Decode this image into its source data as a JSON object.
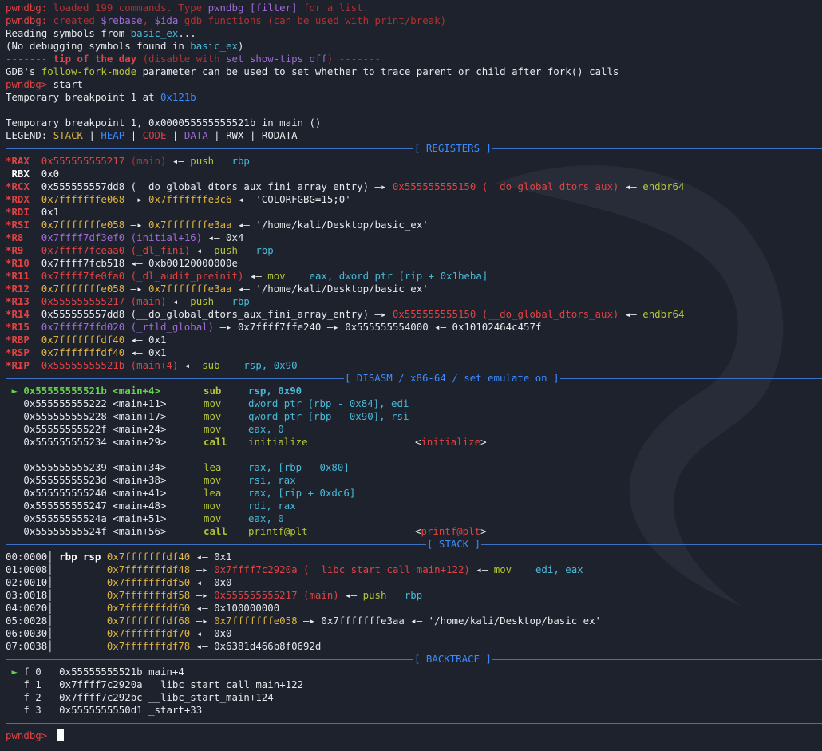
{
  "terminal": {
    "prompt": "pwndbg>",
    "lines": {
      "l1_tag": "pwndbg:",
      "l1_text": " loaded 199 commands. Type ",
      "l1_cmd": "pwndbg [filter]",
      "l1_end": " for a list.",
      "l2_tag": "pwndbg:",
      "l2_text": " created ",
      "l2_rebase": "$rebase",
      "l2_comma": ", ",
      "l2_ida": "$ida",
      "l2_end": " gdb functions (can be used with print/break)",
      "l3_text": "Reading symbols from ",
      "l3_file": "basic_ex",
      "l3_end": "...",
      "l4_text": "(No debugging symbols found in ",
      "l4_file": "basic_ex",
      "l4_end": ")",
      "l5_dash1": "------- ",
      "l5_tip": "tip of the day",
      "l5_mid": " (disable with ",
      "l5_cmd": "set show-tips off",
      "l5_end": ") -------",
      "l6_text": "GDB's ",
      "l6_param": "follow-fork-mode",
      "l6_end": " parameter can be used to set whether to trace parent or child after fork() calls",
      "l7_cmd": " start",
      "l8_text": "Temporary breakpoint 1 at ",
      "l8_addr": "0x121b",
      "l9_text": "Temporary breakpoint 1, 0x000055555555521b in main ()",
      "legend_label": "LEGEND: ",
      "legend_stack": "STACK",
      "legend_heap": "HEAP",
      "legend_code": "CODE",
      "legend_data": "DATA",
      "legend_rwx": "RWX",
      "legend_rodata": "RODATA",
      "legend_sep": " | "
    },
    "sections": {
      "registers": "[ REGISTERS ]",
      "disasm": "[ DISASM / x86-64 / set emulate on ]",
      "stack": "[ STACK ]",
      "backtrace": "[ BACKTRACE ]"
    },
    "registers": [
      {
        "name": "*RAX",
        "a": "0x555555555217",
        "b": " (main)",
        "c": " ◂— ",
        "d": "push",
        "e": "   rbp"
      },
      {
        "name": " RBX",
        "a": "0x0"
      },
      {
        "name": "*RCX",
        "a": "0x555555557dd8 (__do_global_dtors_aux_fini_array_entry) —▸ ",
        "b": "0x555555555150 (__do_global_dtors_aux)",
        "c": " ◂— ",
        "d": "endbr64"
      },
      {
        "name": "*RDX",
        "a": "0x7fffffffe068",
        "b": " —▸ ",
        "c": "0x7fffffffe3c6",
        "d": " ◂— 'COLORFGBG=15;0'"
      },
      {
        "name": "*RDI",
        "a": "0x1"
      },
      {
        "name": "*RSI",
        "a": "0x7fffffffe058",
        "b": " —▸ ",
        "c": "0x7fffffffe3aa",
        "d": " ◂— '/home/kali/Desktop/basic_ex'"
      },
      {
        "name": "*R8",
        "a": "0x7ffff7df3ef0 (initial+16)",
        "b": " ◂— 0x4"
      },
      {
        "name": "*R9",
        "a": "0x7ffff7fceaa0 (_dl_fini)",
        "b": " ◂— ",
        "c": "push",
        "d": "   rbp"
      },
      {
        "name": "*R10",
        "a": "0x7ffff7fcb518 ◂— 0xb00120000000e"
      },
      {
        "name": "*R11",
        "a": "0x7ffff7fe0fa0 (_dl_audit_preinit)",
        "b": " ◂— ",
        "c": "mov",
        "d": "    eax, dword ptr [rip + 0x1beba]"
      },
      {
        "name": "*R12",
        "a": "0x7fffffffe058",
        "b": " —▸ ",
        "c": "0x7fffffffe3aa",
        "d": " ◂— '/home/kali/Desktop/basic_ex'"
      },
      {
        "name": "*R13",
        "a": "0x555555555217 (main)",
        "b": " ◂— ",
        "c": "push",
        "d": "   rbp"
      },
      {
        "name": "*R14",
        "a": "0x555555557dd8 (__do_global_dtors_aux_fini_array_entry) —▸ ",
        "b": "0x555555555150 (__do_global_dtors_aux)",
        "c": " ◂— ",
        "d": "endbr64"
      },
      {
        "name": "*R15",
        "a": "0x7ffff7ffd020 (_rtld_global)",
        "b": " —▸ ",
        "c": "0x7ffff7ffe240 —▸ 0x555555554000 ◂— 0x10102464c457f"
      },
      {
        "name": "*RBP",
        "a": "0x7fffffffdf40",
        "b": " ◂— 0x1"
      },
      {
        "name": "*RSP",
        "a": "0x7fffffffdf40",
        "b": " ◂— 0x1"
      },
      {
        "name": "*RIP",
        "a": "0x55555555521b (main+4)",
        "b": " ◂— ",
        "c": "sub",
        "d": "    rsp, 0x90"
      }
    ],
    "disasm": [
      {
        "mark": " ► ",
        "addr": "0x55555555521b",
        "sym": " <main+4>",
        "mn": "sub",
        "ops": "rsp, 0x90",
        "tgt": "",
        "current": true
      },
      {
        "mark": "   ",
        "addr": "0x555555555222",
        "sym": " <main+11>",
        "mn": "mov",
        "ops": "dword ptr [rbp - 0x84], edi",
        "tgt": ""
      },
      {
        "mark": "   ",
        "addr": "0x555555555228",
        "sym": " <main+17>",
        "mn": "mov",
        "ops": "qword ptr [rbp - 0x90], rsi",
        "tgt": ""
      },
      {
        "mark": "   ",
        "addr": "0x55555555522f",
        "sym": " <main+24>",
        "mn": "mov",
        "ops": "eax, 0",
        "tgt": ""
      },
      {
        "mark": "   ",
        "addr": "0x555555555234",
        "sym": " <main+29>",
        "mn": "call",
        "ops": "initialize",
        "tgt": "initialize",
        "call": true
      },
      {
        "blank": true
      },
      {
        "mark": "   ",
        "addr": "0x555555555239",
        "sym": " <main+34>",
        "mn": "lea",
        "ops": "rax, [rbp - 0x80]",
        "tgt": ""
      },
      {
        "mark": "   ",
        "addr": "0x55555555523d",
        "sym": " <main+38>",
        "mn": "mov",
        "ops": "rsi, rax",
        "tgt": ""
      },
      {
        "mark": "   ",
        "addr": "0x555555555240",
        "sym": " <main+41>",
        "mn": "lea",
        "ops": "rax, [rip + 0xdc6]",
        "tgt": ""
      },
      {
        "mark": "   ",
        "addr": "0x555555555247",
        "sym": " <main+48>",
        "mn": "mov",
        "ops": "rdi, rax",
        "tgt": ""
      },
      {
        "mark": "   ",
        "addr": "0x55555555524a",
        "sym": " <main+51>",
        "mn": "mov",
        "ops": "eax, 0",
        "tgt": ""
      },
      {
        "mark": "   ",
        "addr": "0x55555555524f",
        "sym": " <main+56>",
        "mn": "call",
        "ops": "printf@plt",
        "tgt": "printf@plt",
        "call": true
      }
    ],
    "stack": [
      {
        "idx": "00:0000",
        "regs": " rbp rsp ",
        "addr": "0x7fffffffdf40",
        "rest": " ◂— 0x1"
      },
      {
        "idx": "01:0008",
        "regs": "         ",
        "addr": "0x7fffffffdf48",
        "arrow": " —▸ ",
        "ptr": "0x7ffff7c2920a (__libc_start_call_main+122)",
        "tail": " ◂— ",
        "mn": "mov",
        "ops": "    edi, eax"
      },
      {
        "idx": "02:0010",
        "regs": "         ",
        "addr": "0x7fffffffdf50",
        "rest": " ◂— 0x0"
      },
      {
        "idx": "03:0018",
        "regs": "         ",
        "addr": "0x7fffffffdf58",
        "arrow": " —▸ ",
        "ptr": "0x555555555217 (main)",
        "tail": " ◂— ",
        "mn": "push",
        "ops": "   rbp"
      },
      {
        "idx": "04:0020",
        "regs": "         ",
        "addr": "0x7fffffffdf60",
        "rest": " ◂— 0x100000000"
      },
      {
        "idx": "05:0028",
        "regs": "         ",
        "addr": "0x7fffffffdf68",
        "arrow": " —▸ ",
        "ptr2": "0x7fffffffe058",
        "rest2": " —▸ 0x7fffffffe3aa ◂— '/home/kali/Desktop/basic_ex'"
      },
      {
        "idx": "06:0030",
        "regs": "         ",
        "addr": "0x7fffffffdf70",
        "rest": " ◂— 0x0"
      },
      {
        "idx": "07:0038",
        "regs": "         ",
        "addr": "0x7fffffffdf78",
        "rest": " ◂— 0x6381d466b8f0692d"
      }
    ],
    "backtrace": [
      {
        "mark": " ► ",
        "frame": "f 0",
        "addr": "0x55555555521b",
        "fn": " main+4"
      },
      {
        "mark": "   ",
        "frame": "f 1",
        "addr": "0x7ffff7c2920a",
        "fn": " __libc_start_call_main+122"
      },
      {
        "mark": "   ",
        "frame": "f 2",
        "addr": "0x7ffff7c292bc",
        "fn": " __libc_start_main+124"
      },
      {
        "mark": "   ",
        "frame": "f 3",
        "addr": "0x5555555550d1",
        "fn": " _start+33"
      }
    ]
  }
}
